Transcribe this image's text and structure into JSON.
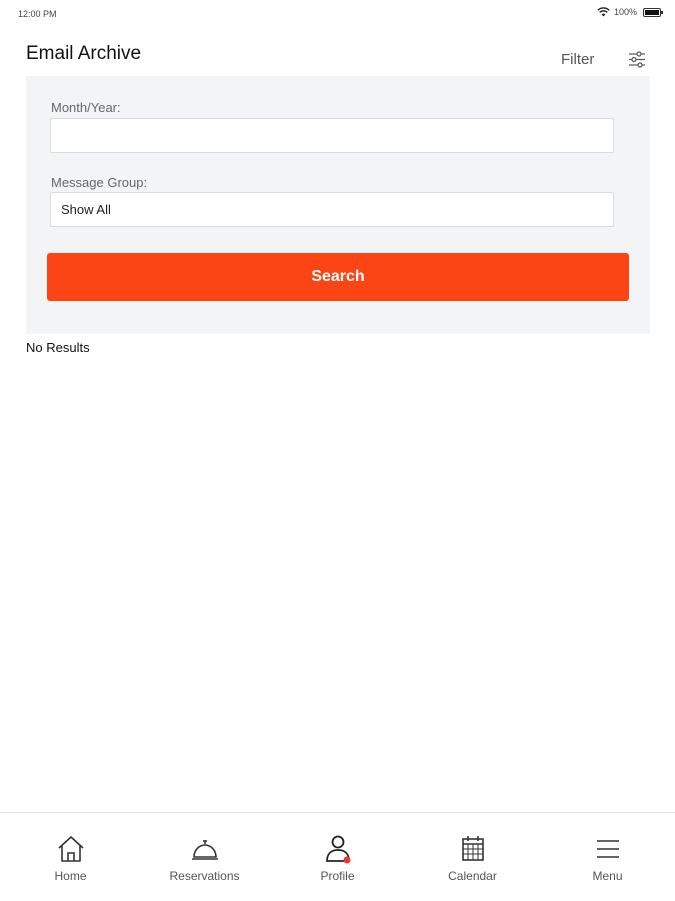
{
  "status_bar": {
    "time": "12:00 PM",
    "battery": "100%"
  },
  "header": {
    "title": "Email Archive",
    "filter_label": "Filter"
  },
  "form": {
    "month_year_label": "Month/Year:",
    "month_year_value": "",
    "message_group_label": "Message Group:",
    "message_group_value": "Show All",
    "search_label": "Search"
  },
  "results": {
    "empty_text": "No Results"
  },
  "nav": {
    "items": [
      {
        "label": "Home",
        "icon": "home-icon"
      },
      {
        "label": "Reservations",
        "icon": "bell-icon"
      },
      {
        "label": "Profile",
        "icon": "profile-icon"
      },
      {
        "label": "Calendar",
        "icon": "calendar-icon"
      },
      {
        "label": "Menu",
        "icon": "menu-icon"
      }
    ]
  },
  "colors": {
    "accent": "#fb4514",
    "panel": "#f3f4f6",
    "notification_dot": "#e53935"
  }
}
